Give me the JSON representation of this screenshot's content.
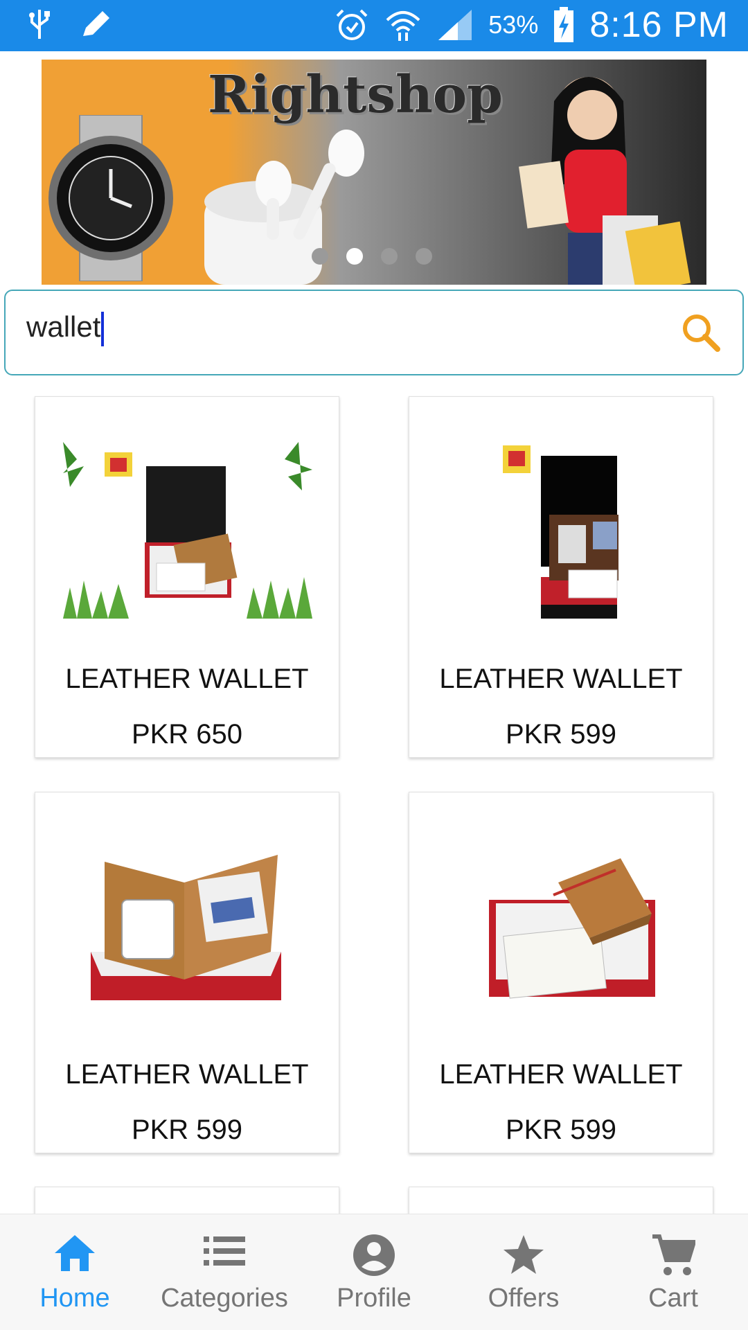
{
  "status_bar": {
    "battery": "53%",
    "time": "8:16 PM"
  },
  "banner": {
    "title": "Rightshop",
    "slide_count": 4,
    "active_slide": 2
  },
  "search": {
    "value": "wallet"
  },
  "products": [
    {
      "name": "LEATHER WALLET",
      "price": "PKR 650"
    },
    {
      "name": "LEATHER WALLET",
      "price": "PKR 599"
    },
    {
      "name": "LEATHER WALLET",
      "price": "PKR 599"
    },
    {
      "name": "LEATHER WALLET",
      "price": "PKR 599"
    }
  ],
  "nav": [
    {
      "label": "Home",
      "icon": "home-icon",
      "active": true
    },
    {
      "label": "Categories",
      "icon": "list-icon"
    },
    {
      "label": "Profile",
      "icon": "account-circle-icon"
    },
    {
      "label": "Offers",
      "icon": "star-icon"
    },
    {
      "label": "Cart",
      "icon": "cart-icon"
    }
  ],
  "colors": {
    "status_bar": "#1a8ae8",
    "accent": "#2196f3",
    "search_border": "#45a7b8",
    "search_icon": "#f0a020"
  }
}
